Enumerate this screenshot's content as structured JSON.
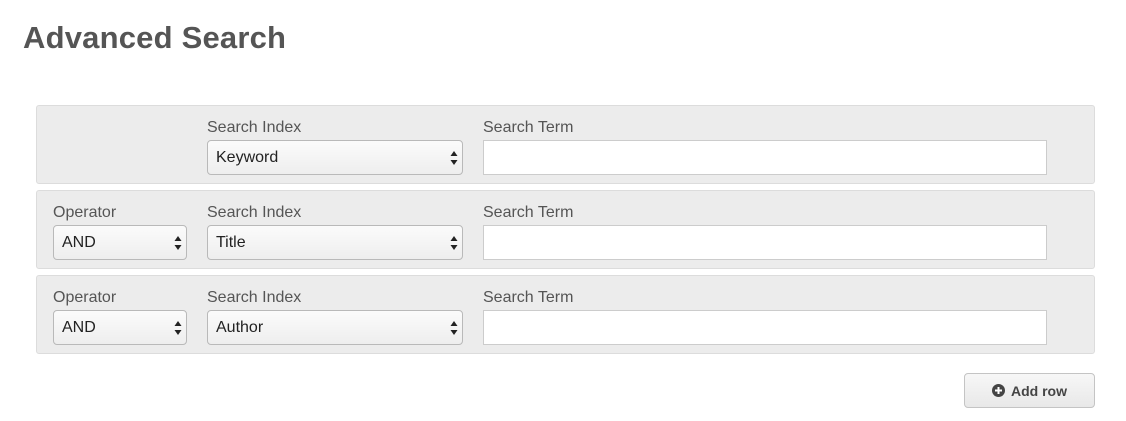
{
  "page": {
    "title": "Advanced Search"
  },
  "rows": [
    {
      "operator_label": "",
      "operator_value": "",
      "index_label": "Search Index",
      "index_value": "Keyword",
      "term_label": "Search Term",
      "term_value": ""
    },
    {
      "operator_label": "Operator",
      "operator_value": "AND",
      "index_label": "Search Index",
      "index_value": "Title",
      "term_label": "Search Term",
      "term_value": ""
    },
    {
      "operator_label": "Operator",
      "operator_value": "AND",
      "index_label": "Search Index",
      "index_value": "Author",
      "term_label": "Search Term",
      "term_value": ""
    }
  ],
  "actions": {
    "add_row_label": "Add row",
    "add_row_icon": "plus-circle-icon"
  },
  "colors": {
    "row_background": "#ececec",
    "title_text": "#555555"
  }
}
